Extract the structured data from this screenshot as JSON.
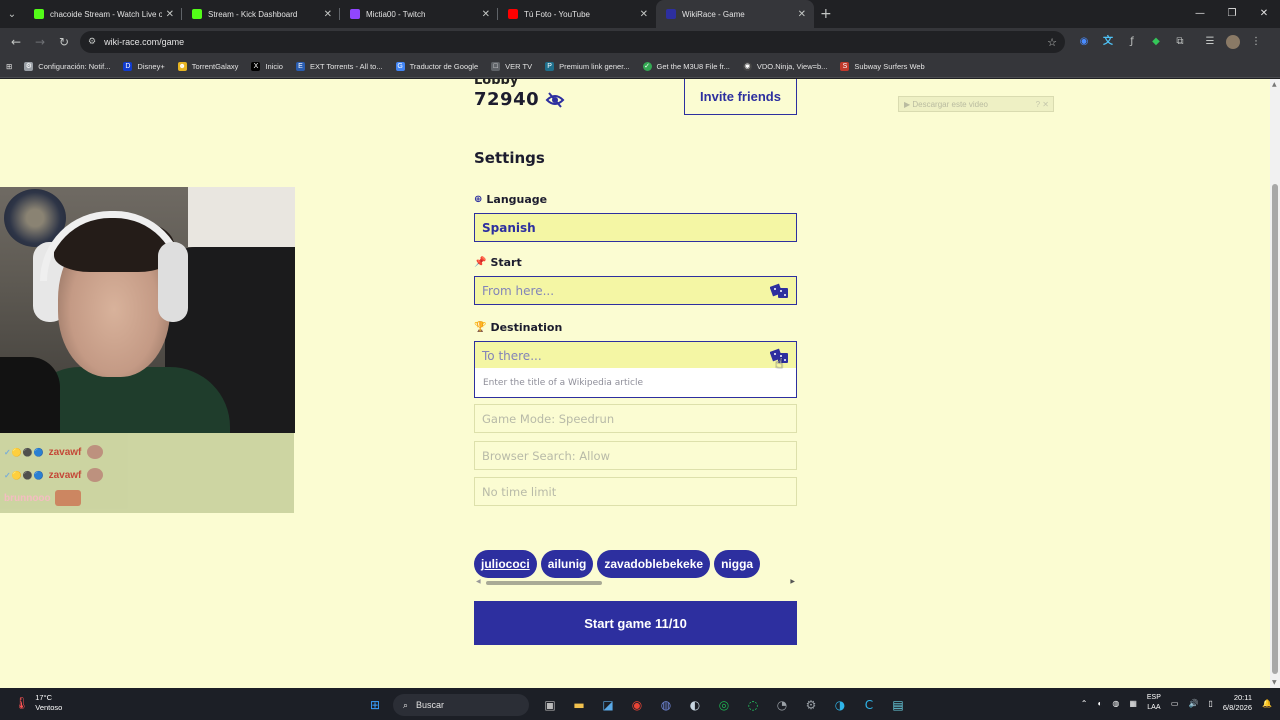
{
  "tabs": [
    {
      "title": "chacoide Stream - Watch Live o",
      "color": "#53fc18",
      "active": false
    },
    {
      "title": "Stream - Kick Dashboard",
      "color": "#53fc18",
      "active": false
    },
    {
      "title": "Mictia00 - Twitch",
      "color": "#9146ff",
      "active": false
    },
    {
      "title": "Tú Foto - YouTube",
      "color": "#ff0000",
      "active": false
    },
    {
      "title": "WikiRace - Game",
      "color": "#2d2f9f",
      "active": true
    }
  ],
  "address": {
    "url": "wiki-race.com/game"
  },
  "bookmarks": [
    {
      "label": "Configuración: Notif...",
      "color": "#9aa0a6",
      "glyph": "⚙"
    },
    {
      "label": "Disney+",
      "color": "#113ccf",
      "glyph": "D"
    },
    {
      "label": "TorrentGalaxy",
      "color": "#e6b422",
      "glyph": "☻"
    },
    {
      "label": "Inicio",
      "color": "#000000",
      "glyph": "X"
    },
    {
      "label": "EXT Torrents - All to...",
      "color": "#2a5db0",
      "glyph": "E"
    },
    {
      "label": "Traductor de Google",
      "color": "#4285f4",
      "glyph": "G"
    },
    {
      "label": "VER TV",
      "color": "#5f6368",
      "glyph": "□"
    },
    {
      "label": "Premium link gener...",
      "color": "#1f6f8b",
      "glyph": "P"
    },
    {
      "label": "Get the M3U8 File fr...",
      "color": "#34a853",
      "glyph": "✓"
    },
    {
      "label": "VDO.Ninja, View=b...",
      "color": "#444444",
      "glyph": "◉"
    },
    {
      "label": "Subway Surfers Web",
      "color": "#c0392b",
      "glyph": "S"
    }
  ],
  "lobby": {
    "label": "Lobby",
    "code": "72940"
  },
  "invite_label": "Invite friends",
  "download_video": {
    "label": "▶ Descargar este video",
    "tail": "? ✕"
  },
  "settings": {
    "title": "Settings",
    "language_label": "Language",
    "language_value": "Spanish",
    "start_label": "Start",
    "start_placeholder": "From here...",
    "destination_label": "Destination",
    "destination_placeholder": "To there...",
    "destination_hint": "Enter the title of a Wikipedia article",
    "game_mode": "Game Mode: Speedrun",
    "browser_search": "Browser Search: Allow",
    "time_limit": "No time limit"
  },
  "players": [
    "juliococi",
    "ailunig",
    "zavadoblebekeke",
    "nigga"
  ],
  "start_button": "Start game 11/10",
  "chat": [
    {
      "user": "zavawf",
      "badges": "✓🟡⚫🔵",
      "color": "red"
    },
    {
      "user": "zavawf",
      "badges": "✓🟡⚫🔵",
      "color": "red"
    },
    {
      "user": "brunnooo",
      "badges": "",
      "color": "pink"
    }
  ],
  "taskbar": {
    "temperature": "17°C",
    "weather": "Ventoso",
    "search_placeholder": "Buscar",
    "lang_top": "ESP",
    "lang_bottom": "LAA",
    "time": "20:11",
    "date": "6/8/2026"
  },
  "colors": {
    "accent": "#2d2f9f",
    "page_bg": "#fbfcd2",
    "input_bg": "#f4f6a4"
  }
}
